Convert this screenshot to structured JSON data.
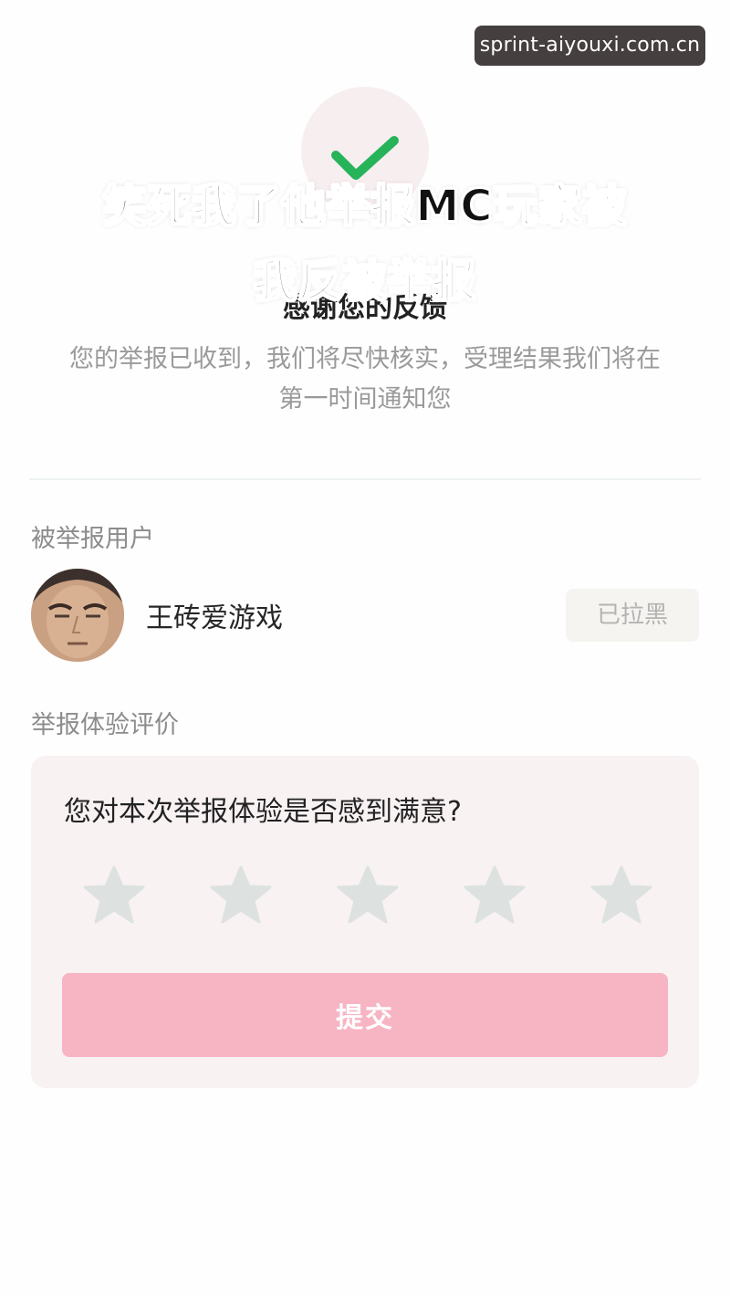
{
  "watermark": {
    "text": "sprint-aiyouxi.com.cn"
  },
  "caption": {
    "line1": "笑死我了他举报MC玩家被",
    "line2": "我反被举报"
  },
  "result": {
    "title": "感谢您的反馈",
    "description_line1": "您的举报已收到，我们将尽快核实，受理结果我们将在",
    "description_line2": "第一时间通知您",
    "icon": "check-icon",
    "accent_color": "#27b35a"
  },
  "reported_user": {
    "section_label": "被举报用户",
    "name": "王砖爱游戏",
    "avatar_icon": "avatar",
    "blocked_label": "已拉黑"
  },
  "rating": {
    "section_label": "举报体验评价",
    "question": "您对本次举报体验是否感到满意?",
    "star_count": 5,
    "selected_stars": 0,
    "star_color": "#dde2e1",
    "submit_label": "提交",
    "submit_color": "#f7b5c4"
  }
}
